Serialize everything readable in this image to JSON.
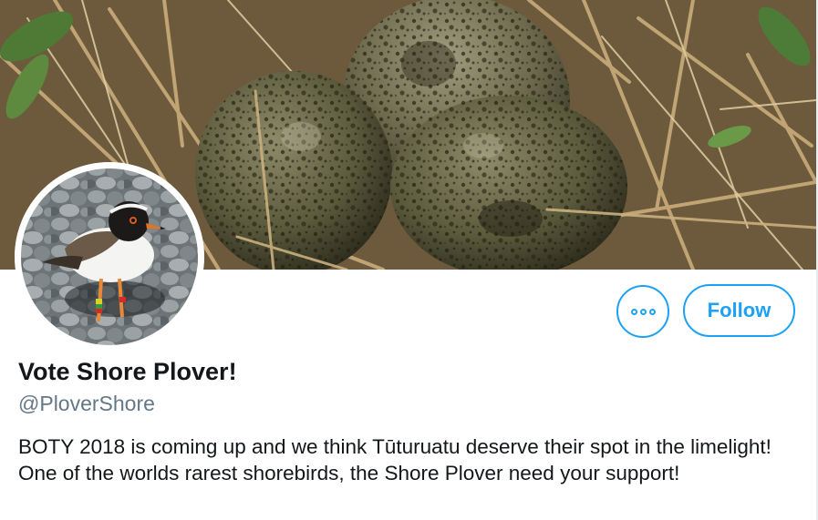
{
  "profile": {
    "display_name": "Vote Shore Plover!",
    "handle": "@PloverShore",
    "bio": "BOTY 2018 is coming up and we think Tūturuatu deserve their spot in the limelight! One of the worlds rarest shorebirds, the Shore Plover need your support!",
    "banner_image": "bird-eggs-in-nest-photo",
    "avatar_image": "shore-plover-photo"
  },
  "actions": {
    "more_icon": "more-options-icon",
    "follow_label": "Follow"
  },
  "colors": {
    "accent": "#1da1f2",
    "text": "#14171a",
    "secondary_text": "#657786"
  }
}
